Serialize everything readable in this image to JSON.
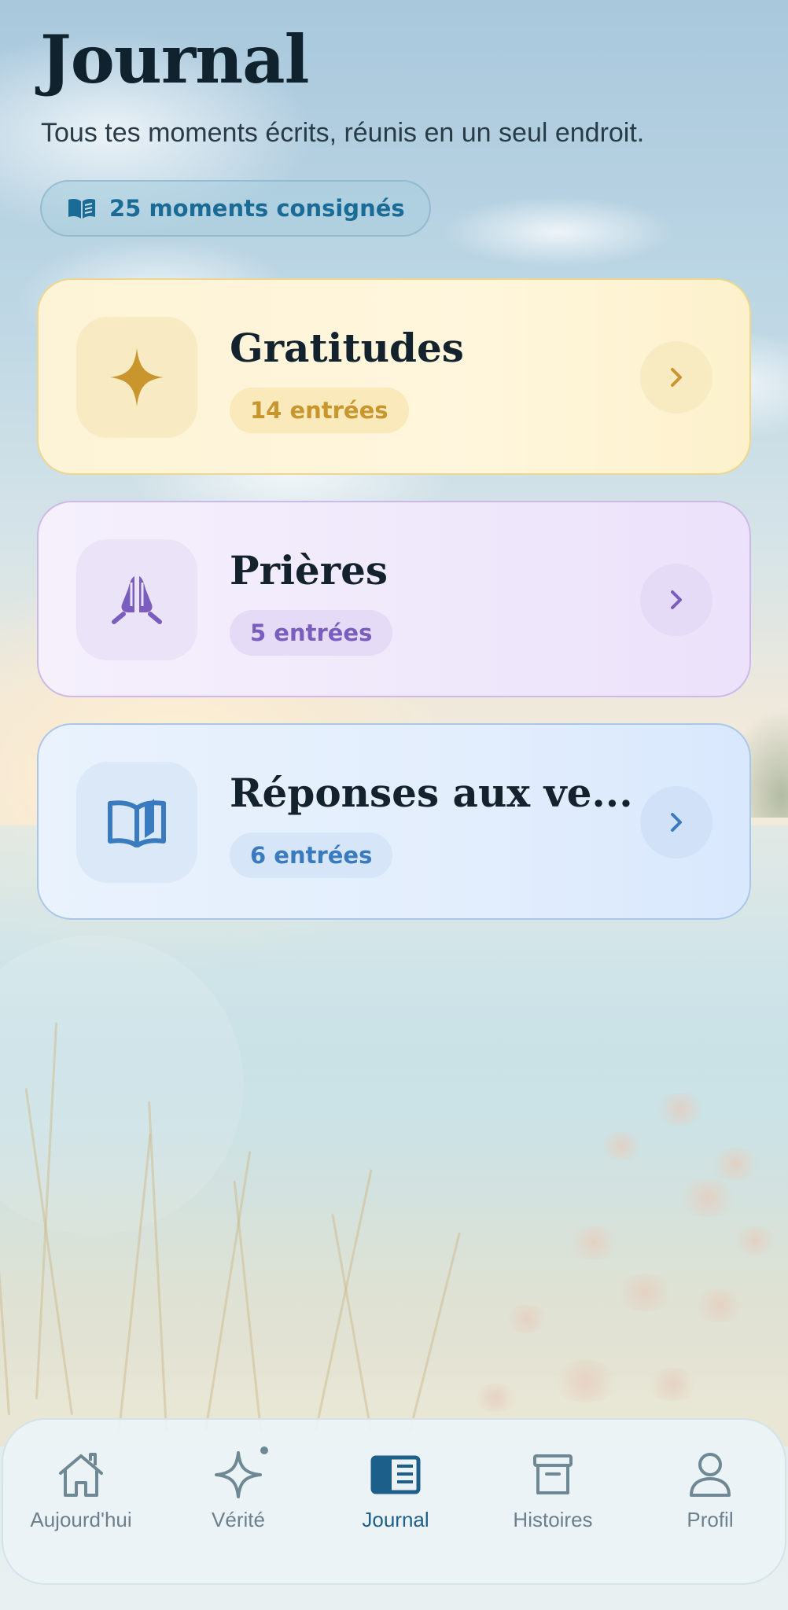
{
  "header": {
    "title": "Journal",
    "subtitle": "Tous tes moments écrits, réunis en un seul endroit.",
    "count_label": "25 moments consignés",
    "count_icon": "book-open-icon"
  },
  "categories": [
    {
      "title": "Gratitudes",
      "entries": "14 entrées",
      "icon": "sparkle-icon",
      "accent": "#c9952d"
    },
    {
      "title": "Prières",
      "entries": "5 entrées",
      "icon": "praying-hands-icon",
      "accent": "#7a5dbe"
    },
    {
      "title": "Réponses aux ve...",
      "entries": "6 entrées",
      "icon": "open-book-icon",
      "accent": "#3a7bbf"
    }
  ],
  "tab_bar": {
    "active": "Journal",
    "tabs": [
      {
        "label": "Aujourd'hui",
        "icon": "home-icon"
      },
      {
        "label": "Vérité",
        "icon": "sparkle-icon"
      },
      {
        "label": "Journal",
        "icon": "journal-icon"
      },
      {
        "label": "Histoires",
        "icon": "archive-icon"
      },
      {
        "label": "Profil",
        "icon": "profile-icon"
      }
    ]
  },
  "colors": {
    "title": "#10222e",
    "tab_active": "#1c5f8a",
    "tab_inactive": "#6c7f8c"
  }
}
